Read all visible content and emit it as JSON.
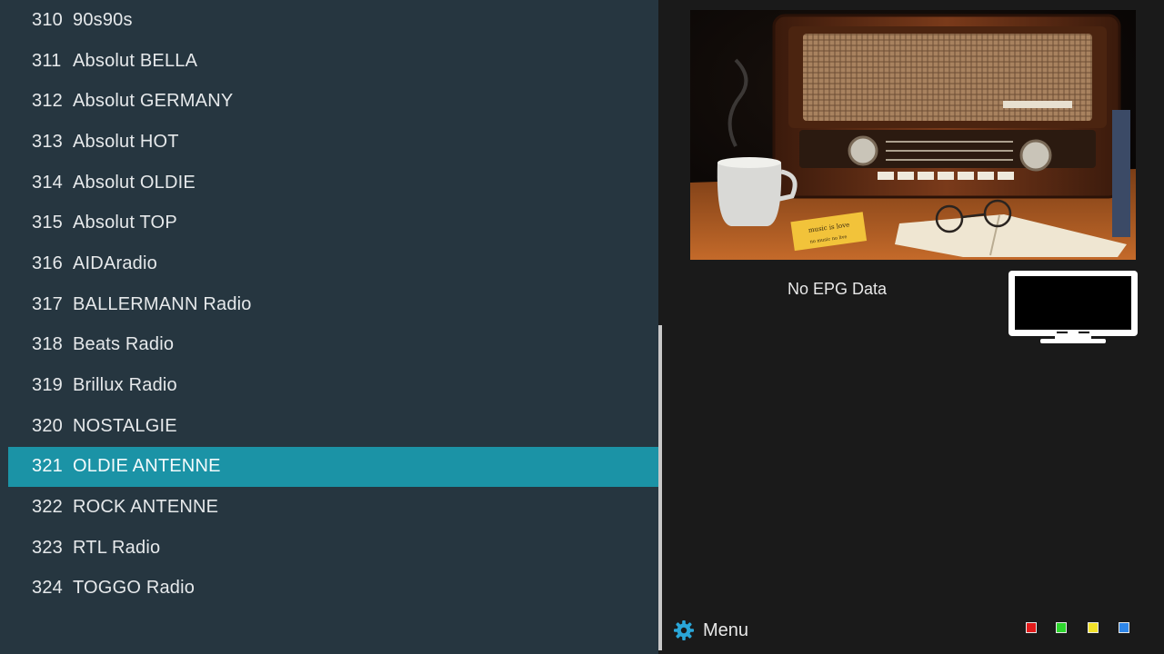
{
  "channels": [
    {
      "number": "310",
      "name": "90s90s",
      "selected": false
    },
    {
      "number": "311",
      "name": "Absolut BELLA",
      "selected": false
    },
    {
      "number": "312",
      "name": "Absolut GERMANY",
      "selected": false
    },
    {
      "number": "313",
      "name": "Absolut HOT",
      "selected": false
    },
    {
      "number": "314",
      "name": "Absolut OLDIE",
      "selected": false
    },
    {
      "number": "315",
      "name": "Absolut TOP",
      "selected": false
    },
    {
      "number": "316",
      "name": "AIDAradio",
      "selected": false
    },
    {
      "number": "317",
      "name": "BALLERMANN Radio",
      "selected": false
    },
    {
      "number": "318",
      "name": "Beats Radio",
      "selected": false
    },
    {
      "number": "319",
      "name": "Brillux Radio",
      "selected": false
    },
    {
      "number": "320",
      "name": "NOSTALGIE",
      "selected": false
    },
    {
      "number": "321",
      "name": "OLDIE ANTENNE",
      "selected": true
    },
    {
      "number": "322",
      "name": "ROCK ANTENNE",
      "selected": false
    },
    {
      "number": "323",
      "name": "RTL Radio",
      "selected": false
    },
    {
      "number": "324",
      "name": "TOGGO Radio",
      "selected": false
    }
  ],
  "artwork": {
    "note_line1": "music is love",
    "note_line2": "no music no live"
  },
  "epg": {
    "text": "No EPG Data"
  },
  "footer": {
    "menu_label": "Menu",
    "menu_icon": "gear-icon",
    "color_keys": [
      {
        "name": "red-key",
        "color": "#e21b1b"
      },
      {
        "name": "green-key",
        "color": "#2ed62e"
      },
      {
        "name": "yellow-key",
        "color": "#f2e12a"
      },
      {
        "name": "blue-key",
        "color": "#2f86e8"
      }
    ]
  },
  "colors": {
    "list_background": "#263640",
    "selection": "#1b93a6",
    "accent_gear": "#2aa6d8"
  }
}
